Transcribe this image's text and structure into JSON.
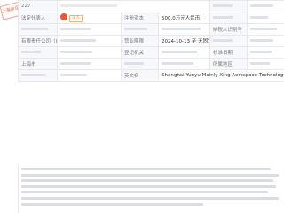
{
  "stamp": {
    "text": "上海市企业名录"
  },
  "rows": {
    "r1": {
      "index": "227"
    },
    "r2": {
      "legal_rep_label": "法定代表人",
      "legal_rep_avatar": "梁",
      "legal_rep_badge": "法人",
      "registered_capital_label": "注册资本",
      "registered_capital_value": "500.0万元人民币"
    },
    "r3": {
      "label_a": "统一社会信用代码",
      "label_b": "纳税人识别号"
    },
    "r4": {
      "company_type": "有限责任公司（自然人投资或控股）",
      "term_label": "营业期限",
      "term_value": "2024-10-13 至 无固定期限"
    },
    "r5": {
      "label_a": "登记机关",
      "label_b": "核准日期"
    },
    "r6": {
      "region": "上海市",
      "label_b": "所属地区"
    },
    "r7": {
      "label_b": "英文名",
      "english_name": "Shanghai Yunyu Mainly Xing Aerospace Technology Co., Ltd."
    }
  },
  "scope": {
    "line_count": 7
  },
  "colors": {
    "accent": "#ea5a3c",
    "label_bg": "#f6f8fc",
    "border": "#e9e9e9",
    "badge": "#f08a2c"
  }
}
